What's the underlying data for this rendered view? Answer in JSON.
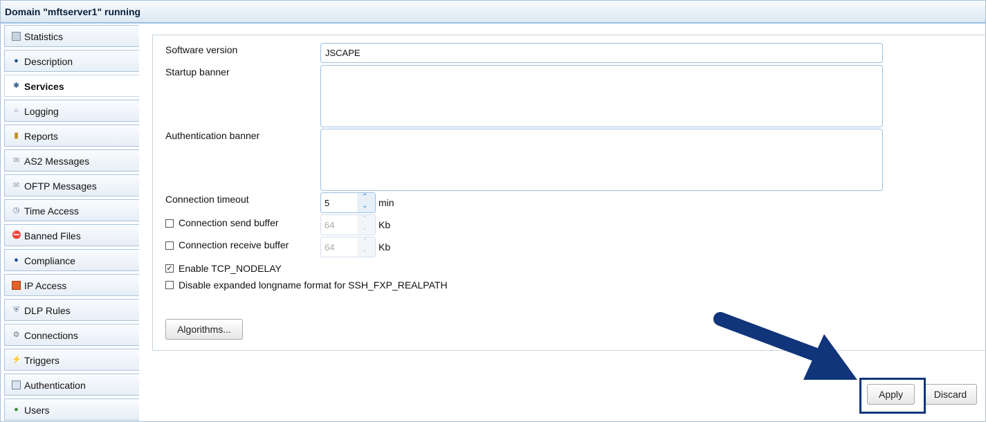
{
  "title": "Domain \"mftserver1\" running",
  "sidebar": {
    "items": [
      {
        "label": "Statistics",
        "icon": "statistics-icon"
      },
      {
        "label": "Description",
        "icon": "person-icon"
      },
      {
        "label": "Services",
        "icon": "services-icon",
        "active": true
      },
      {
        "label": "Logging",
        "icon": "logging-icon"
      },
      {
        "label": "Reports",
        "icon": "bar-chart-icon"
      },
      {
        "label": "AS2 Messages",
        "icon": "messages-icon"
      },
      {
        "label": "OFTP Messages",
        "icon": "messages-icon"
      },
      {
        "label": "Time Access",
        "icon": "time-access-icon"
      },
      {
        "label": "Banned Files",
        "icon": "banned-file-icon"
      },
      {
        "label": "Compliance",
        "icon": "compliance-icon"
      },
      {
        "label": "IP Access",
        "icon": "firewall-icon"
      },
      {
        "label": "DLP Rules",
        "icon": "shield-icon"
      },
      {
        "label": "Connections",
        "icon": "connections-icon"
      },
      {
        "label": "Triggers",
        "icon": "triggers-icon"
      },
      {
        "label": "Authentication",
        "icon": "id-card-icon"
      },
      {
        "label": "Users",
        "icon": "user-icon"
      }
    ]
  },
  "form": {
    "software_version_label": "Software version",
    "software_version_value": "JSCAPE",
    "startup_banner_label": "Startup banner",
    "startup_banner_value": "",
    "auth_banner_label": "Authentication banner",
    "auth_banner_value": "",
    "timeout_label": "Connection timeout",
    "timeout_value": "5",
    "timeout_unit": "min",
    "send_buffer_label": "Connection send buffer",
    "send_buffer_checked": false,
    "send_buffer_value": "64",
    "send_buffer_unit": "Kb",
    "recv_buffer_label": "Connection receive buffer",
    "recv_buffer_checked": false,
    "recv_buffer_value": "64",
    "recv_buffer_unit": "Kb",
    "tcp_nodelay_label": "Enable TCP_NODELAY",
    "tcp_nodelay_checked": true,
    "longname_label": "Disable expanded longname format for SSH_FXP_REALPATH",
    "longname_checked": false,
    "algorithms_button": "Algorithms..."
  },
  "footer": {
    "apply_label": "Apply",
    "discard_label": "Discard"
  },
  "colors": {
    "accent_border": "#9bbfe3",
    "arrow": "#11357a",
    "highlight_box": "#11357a"
  }
}
